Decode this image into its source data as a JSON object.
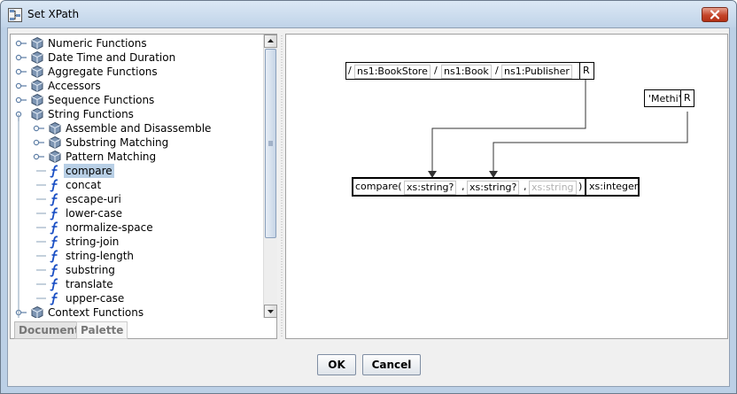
{
  "window": {
    "title": "Set XPath"
  },
  "tree": {
    "items": [
      {
        "label": "Numeric Functions",
        "level": 0,
        "kind": "package"
      },
      {
        "label": "Date Time and Duration",
        "level": 0,
        "kind": "package"
      },
      {
        "label": "Aggregate Functions",
        "level": 0,
        "kind": "package"
      },
      {
        "label": "Accessors",
        "level": 0,
        "kind": "package"
      },
      {
        "label": "Sequence Functions",
        "level": 0,
        "kind": "package"
      },
      {
        "label": "String Functions",
        "level": 0,
        "kind": "package-open"
      },
      {
        "label": "Assemble and Disassemble",
        "level": 1,
        "kind": "package"
      },
      {
        "label": "Substring Matching",
        "level": 1,
        "kind": "package"
      },
      {
        "label": "Pattern Matching",
        "level": 1,
        "kind": "package"
      },
      {
        "label": "compare",
        "level": 1,
        "kind": "function",
        "selected": true
      },
      {
        "label": "concat",
        "level": 1,
        "kind": "function"
      },
      {
        "label": "escape-uri",
        "level": 1,
        "kind": "function"
      },
      {
        "label": "lower-case",
        "level": 1,
        "kind": "function"
      },
      {
        "label": "normalize-space",
        "level": 1,
        "kind": "function"
      },
      {
        "label": "string-join",
        "level": 1,
        "kind": "function"
      },
      {
        "label": "string-length",
        "level": 1,
        "kind": "function"
      },
      {
        "label": "substring",
        "level": 1,
        "kind": "function"
      },
      {
        "label": "translate",
        "level": 1,
        "kind": "function"
      },
      {
        "label": "upper-case",
        "level": 1,
        "kind": "function"
      },
      {
        "label": "Context Functions",
        "level": 0,
        "kind": "package"
      }
    ]
  },
  "tabs": {
    "document": "Document",
    "palette": "Palette"
  },
  "diagram": {
    "path": {
      "root": "/",
      "steps": [
        "ns1:BookStore",
        "ns1:Book",
        "ns1:Publisher"
      ],
      "sep": "/",
      "result": "R"
    },
    "literal": {
      "value": "'Methi'",
      "result": "R"
    },
    "function": {
      "open": "compare(",
      "args": [
        "xs:string?",
        "xs:string?",
        "xs:string"
      ],
      "comma": ",",
      "close": ")",
      "returns": "xs:integer"
    }
  },
  "buttons": {
    "ok": "OK",
    "cancel": "Cancel"
  }
}
